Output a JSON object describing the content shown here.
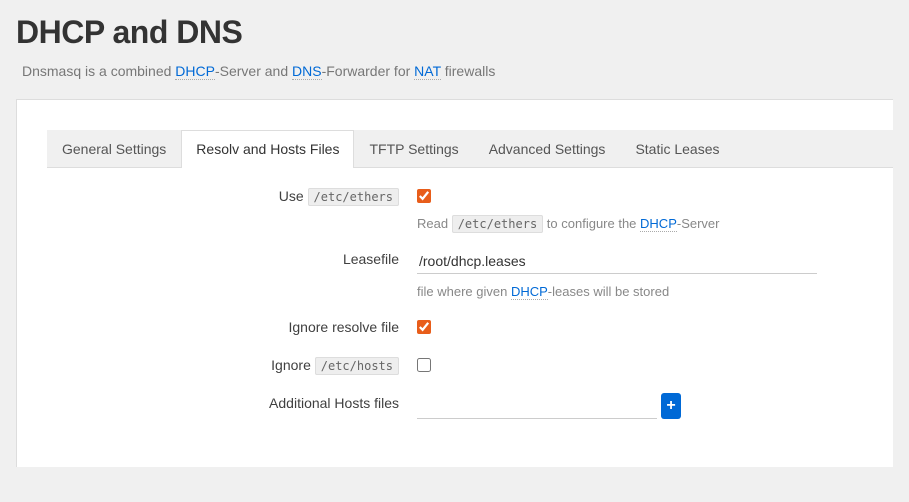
{
  "title": "DHCP and DNS",
  "intro": {
    "prefix": "Dnsmasq is a combined ",
    "dhcp": "DHCP",
    "mid1": "-Server and ",
    "dns": "DNS",
    "mid2": "-Forwarder for ",
    "nat": "NAT",
    "suffix": " firewalls"
  },
  "tabs": [
    {
      "label": "General Settings",
      "active": false
    },
    {
      "label": "Resolv and Hosts Files",
      "active": true
    },
    {
      "label": "TFTP Settings",
      "active": false
    },
    {
      "label": "Advanced Settings",
      "active": false
    },
    {
      "label": "Static Leases",
      "active": false
    }
  ],
  "fields": {
    "use_etc_ethers": {
      "label_prefix": "Use ",
      "label_code": "/etc/ethers",
      "checked": true,
      "hint_prefix": "Read ",
      "hint_code": "/etc/ethers",
      "hint_mid": " to configure the ",
      "hint_link": "DHCP",
      "hint_suffix": "-Server"
    },
    "leasefile": {
      "label": "Leasefile",
      "value": "/root/dhcp.leases",
      "hint_prefix": "file where given ",
      "hint_link": "DHCP",
      "hint_suffix": "-leases will be stored"
    },
    "ignore_resolve": {
      "label": "Ignore resolve file",
      "checked": true
    },
    "ignore_hosts": {
      "label_prefix": "Ignore ",
      "label_code": "/etc/hosts",
      "checked": false
    },
    "additional_hosts": {
      "label": "Additional Hosts files",
      "value": "",
      "add_label": "+"
    }
  }
}
